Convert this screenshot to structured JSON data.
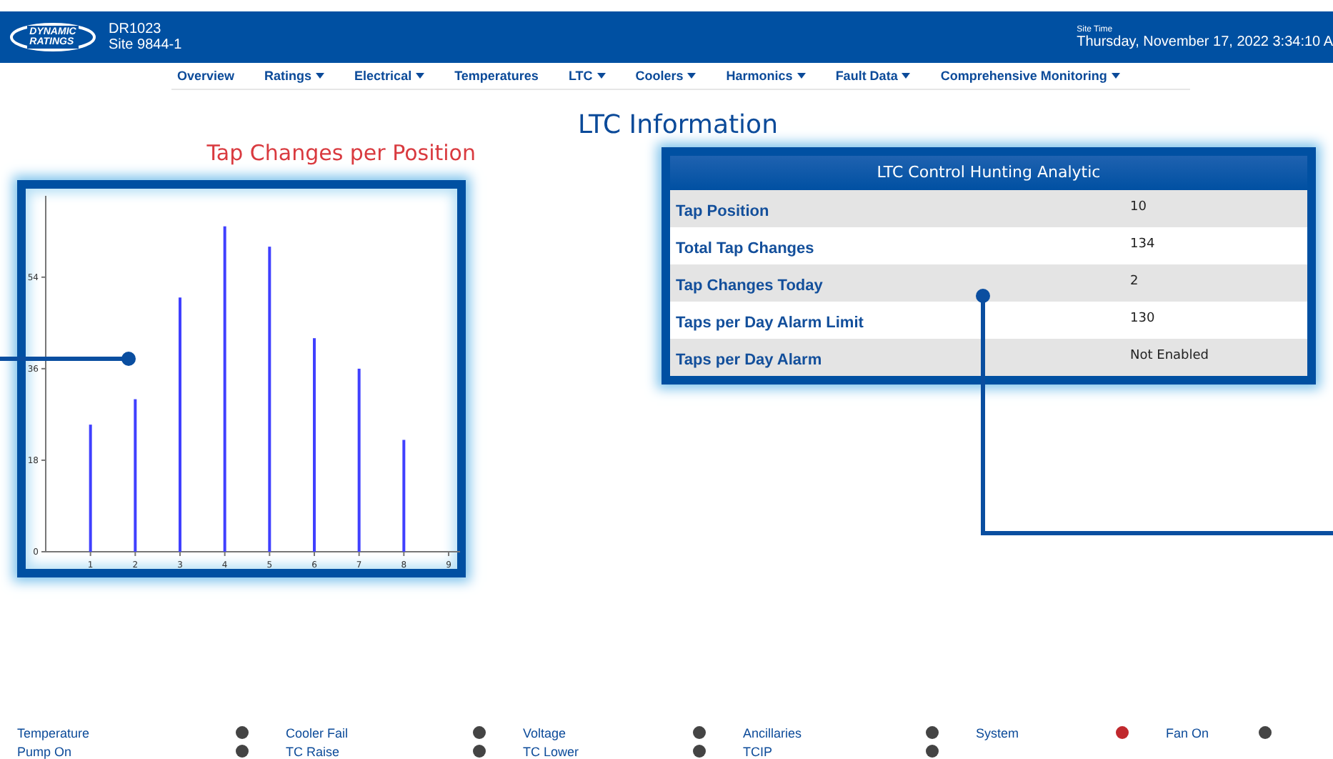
{
  "header": {
    "logo_lines": [
      "DYNAMIC",
      "RATINGS"
    ],
    "device": "DR1023",
    "site": "Site 9844-1",
    "site_time_label": "Site Time",
    "site_time": "Thursday, November 17, 2022  3:34:10 A"
  },
  "nav": [
    {
      "label": "Overview",
      "has_menu": false
    },
    {
      "label": "Ratings",
      "has_menu": true
    },
    {
      "label": "Electrical",
      "has_menu": true
    },
    {
      "label": "Temperatures",
      "has_menu": false
    },
    {
      "label": "LTC",
      "has_menu": true
    },
    {
      "label": "Coolers",
      "has_menu": true
    },
    {
      "label": "Harmonics",
      "has_menu": true
    },
    {
      "label": "Fault Data",
      "has_menu": true
    },
    {
      "label": "Comprehensive Monitoring",
      "has_menu": true
    }
  ],
  "page_title": "LTC Information",
  "chart": {
    "title": "Tap Changes per Position",
    "chart_data": {
      "type": "bar",
      "categories": [
        "1",
        "2",
        "3",
        "4",
        "5",
        "6",
        "7",
        "8",
        "9"
      ],
      "series": [
        {
          "color": "#4040ff",
          "values": [
            25,
            30,
            50,
            64,
            60,
            42,
            36,
            22,
            null
          ]
        }
      ],
      "ylim": [
        0,
        70
      ],
      "yticks": [
        0,
        18,
        36,
        54
      ]
    }
  },
  "analytic": {
    "title": "LTC Control Hunting Analytic",
    "rows": [
      {
        "label": "Tap Position",
        "value": "10"
      },
      {
        "label": "Total Tap Changes",
        "value": "134"
      },
      {
        "label": "Tap Changes Today",
        "value": "2"
      },
      {
        "label": "Taps per Day Alarm Limit",
        "value": "130"
      },
      {
        "label": "Taps per Day Alarm",
        "value": "Not Enabled"
      }
    ]
  },
  "status": [
    {
      "label": "Temperature",
      "color": "#444444"
    },
    {
      "label": "Cooler Fail",
      "color": "#444444"
    },
    {
      "label": "Voltage",
      "color": "#444444"
    },
    {
      "label": "Ancillaries",
      "color": "#444444"
    },
    {
      "label": "System",
      "color": "#c0282d"
    },
    {
      "label": "Fan On",
      "color": "#444444"
    },
    {
      "label": "Pump On",
      "color": "#444444"
    },
    {
      "label": "TC Raise",
      "color": "#444444"
    },
    {
      "label": "TC Lower",
      "color": "#444444"
    },
    {
      "label": "TCIP",
      "color": "#444444"
    }
  ]
}
